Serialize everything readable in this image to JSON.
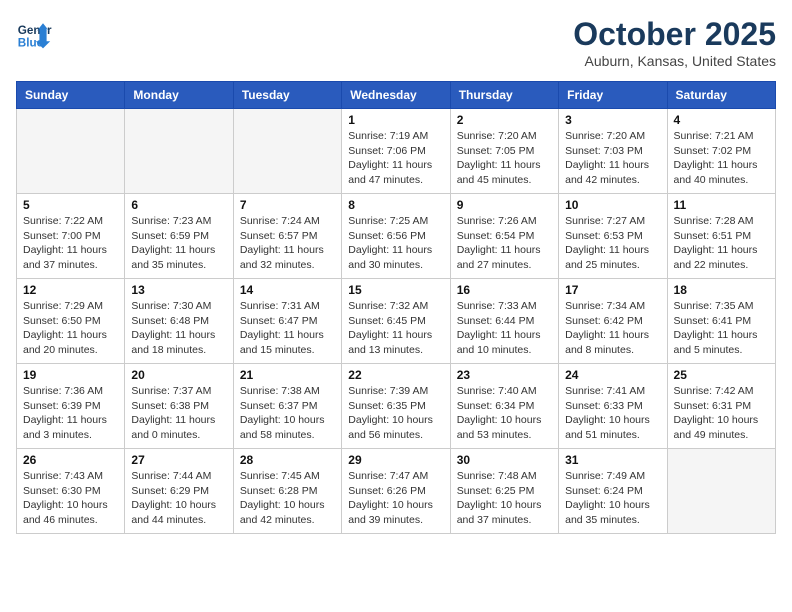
{
  "logo": {
    "line1": "General",
    "line2": "Blue"
  },
  "title": "October 2025",
  "location": "Auburn, Kansas, United States",
  "weekdays": [
    "Sunday",
    "Monday",
    "Tuesday",
    "Wednesday",
    "Thursday",
    "Friday",
    "Saturday"
  ],
  "weeks": [
    [
      {
        "day": "",
        "info": ""
      },
      {
        "day": "",
        "info": ""
      },
      {
        "day": "",
        "info": ""
      },
      {
        "day": "1",
        "info": "Sunrise: 7:19 AM\nSunset: 7:06 PM\nDaylight: 11 hours\nand 47 minutes."
      },
      {
        "day": "2",
        "info": "Sunrise: 7:20 AM\nSunset: 7:05 PM\nDaylight: 11 hours\nand 45 minutes."
      },
      {
        "day": "3",
        "info": "Sunrise: 7:20 AM\nSunset: 7:03 PM\nDaylight: 11 hours\nand 42 minutes."
      },
      {
        "day": "4",
        "info": "Sunrise: 7:21 AM\nSunset: 7:02 PM\nDaylight: 11 hours\nand 40 minutes."
      }
    ],
    [
      {
        "day": "5",
        "info": "Sunrise: 7:22 AM\nSunset: 7:00 PM\nDaylight: 11 hours\nand 37 minutes."
      },
      {
        "day": "6",
        "info": "Sunrise: 7:23 AM\nSunset: 6:59 PM\nDaylight: 11 hours\nand 35 minutes."
      },
      {
        "day": "7",
        "info": "Sunrise: 7:24 AM\nSunset: 6:57 PM\nDaylight: 11 hours\nand 32 minutes."
      },
      {
        "day": "8",
        "info": "Sunrise: 7:25 AM\nSunset: 6:56 PM\nDaylight: 11 hours\nand 30 minutes."
      },
      {
        "day": "9",
        "info": "Sunrise: 7:26 AM\nSunset: 6:54 PM\nDaylight: 11 hours\nand 27 minutes."
      },
      {
        "day": "10",
        "info": "Sunrise: 7:27 AM\nSunset: 6:53 PM\nDaylight: 11 hours\nand 25 minutes."
      },
      {
        "day": "11",
        "info": "Sunrise: 7:28 AM\nSunset: 6:51 PM\nDaylight: 11 hours\nand 22 minutes."
      }
    ],
    [
      {
        "day": "12",
        "info": "Sunrise: 7:29 AM\nSunset: 6:50 PM\nDaylight: 11 hours\nand 20 minutes."
      },
      {
        "day": "13",
        "info": "Sunrise: 7:30 AM\nSunset: 6:48 PM\nDaylight: 11 hours\nand 18 minutes."
      },
      {
        "day": "14",
        "info": "Sunrise: 7:31 AM\nSunset: 6:47 PM\nDaylight: 11 hours\nand 15 minutes."
      },
      {
        "day": "15",
        "info": "Sunrise: 7:32 AM\nSunset: 6:45 PM\nDaylight: 11 hours\nand 13 minutes."
      },
      {
        "day": "16",
        "info": "Sunrise: 7:33 AM\nSunset: 6:44 PM\nDaylight: 11 hours\nand 10 minutes."
      },
      {
        "day": "17",
        "info": "Sunrise: 7:34 AM\nSunset: 6:42 PM\nDaylight: 11 hours\nand 8 minutes."
      },
      {
        "day": "18",
        "info": "Sunrise: 7:35 AM\nSunset: 6:41 PM\nDaylight: 11 hours\nand 5 minutes."
      }
    ],
    [
      {
        "day": "19",
        "info": "Sunrise: 7:36 AM\nSunset: 6:39 PM\nDaylight: 11 hours\nand 3 minutes."
      },
      {
        "day": "20",
        "info": "Sunrise: 7:37 AM\nSunset: 6:38 PM\nDaylight: 11 hours\nand 0 minutes."
      },
      {
        "day": "21",
        "info": "Sunrise: 7:38 AM\nSunset: 6:37 PM\nDaylight: 10 hours\nand 58 minutes."
      },
      {
        "day": "22",
        "info": "Sunrise: 7:39 AM\nSunset: 6:35 PM\nDaylight: 10 hours\nand 56 minutes."
      },
      {
        "day": "23",
        "info": "Sunrise: 7:40 AM\nSunset: 6:34 PM\nDaylight: 10 hours\nand 53 minutes."
      },
      {
        "day": "24",
        "info": "Sunrise: 7:41 AM\nSunset: 6:33 PM\nDaylight: 10 hours\nand 51 minutes."
      },
      {
        "day": "25",
        "info": "Sunrise: 7:42 AM\nSunset: 6:31 PM\nDaylight: 10 hours\nand 49 minutes."
      }
    ],
    [
      {
        "day": "26",
        "info": "Sunrise: 7:43 AM\nSunset: 6:30 PM\nDaylight: 10 hours\nand 46 minutes."
      },
      {
        "day": "27",
        "info": "Sunrise: 7:44 AM\nSunset: 6:29 PM\nDaylight: 10 hours\nand 44 minutes."
      },
      {
        "day": "28",
        "info": "Sunrise: 7:45 AM\nSunset: 6:28 PM\nDaylight: 10 hours\nand 42 minutes."
      },
      {
        "day": "29",
        "info": "Sunrise: 7:47 AM\nSunset: 6:26 PM\nDaylight: 10 hours\nand 39 minutes."
      },
      {
        "day": "30",
        "info": "Sunrise: 7:48 AM\nSunset: 6:25 PM\nDaylight: 10 hours\nand 37 minutes."
      },
      {
        "day": "31",
        "info": "Sunrise: 7:49 AM\nSunset: 6:24 PM\nDaylight: 10 hours\nand 35 minutes."
      },
      {
        "day": "",
        "info": ""
      }
    ]
  ]
}
